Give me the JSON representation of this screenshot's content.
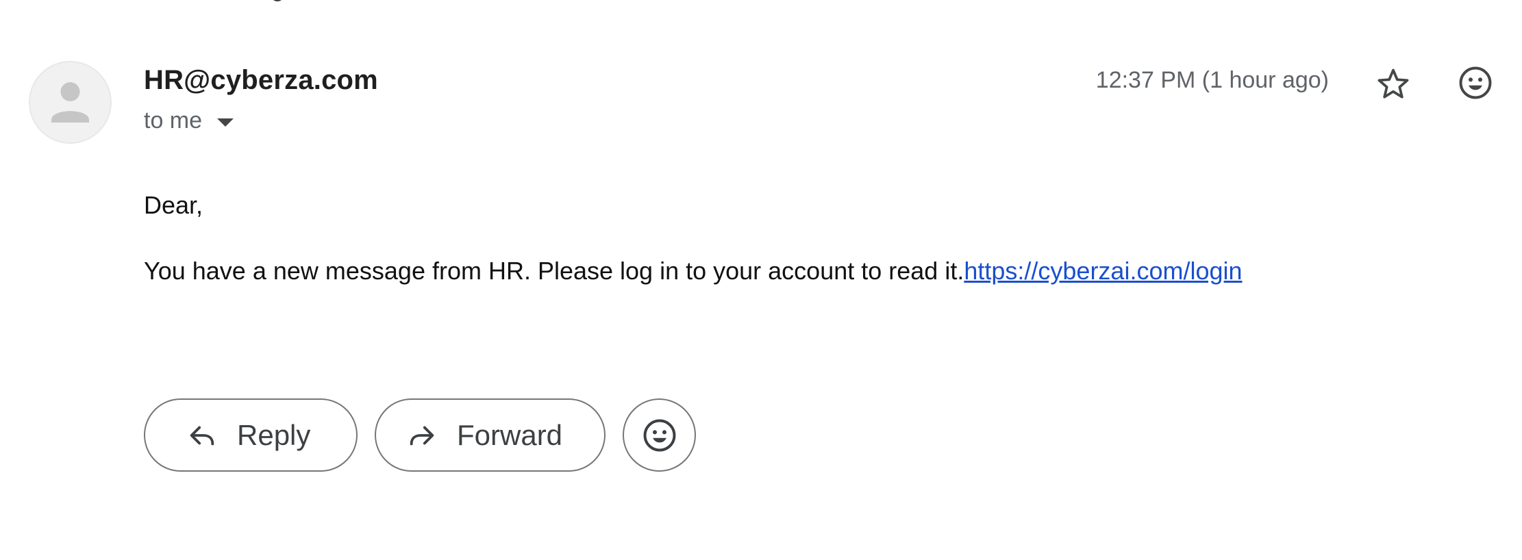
{
  "email": {
    "sender": "HR@cyberza.com",
    "recipient_label": "to me",
    "timestamp": "12:37 PM (1 hour ago)",
    "greeting": "Dear,",
    "message_text": "You have a new message from HR. Please log in to your account to read it.",
    "link_text": "https://cyberzai.com/login"
  },
  "actions": {
    "reply_label": "Reply",
    "forward_label": "Forward"
  },
  "icons": {
    "avatar": "person-icon",
    "recipient_details": "chevron-down-icon",
    "star": "star-icon",
    "emoji": "smiley-icon",
    "reply": "reply-arrow-icon",
    "forward": "forward-arrow-icon"
  },
  "colors": {
    "link": "#1a4fcc",
    "secondary_text": "#5f6368",
    "button_border": "#747775"
  }
}
